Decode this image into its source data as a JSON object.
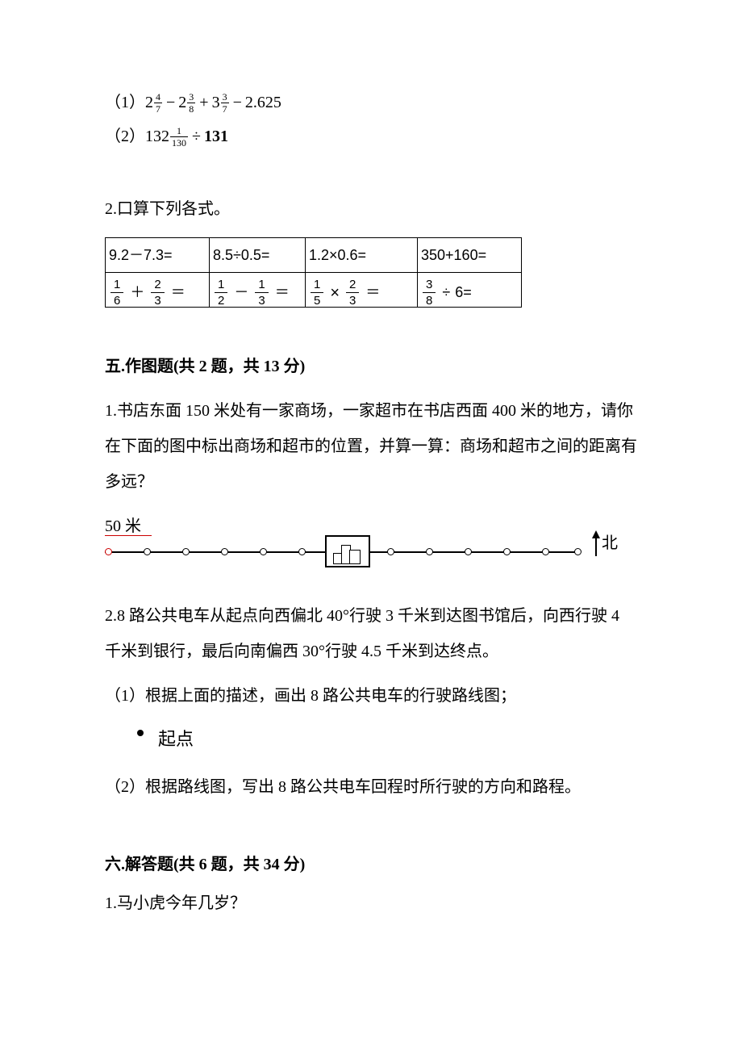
{
  "eq1": {
    "prefix": "（1）",
    "a_int": "2",
    "a_num": "4",
    "a_den": "7",
    "b_int": "2",
    "b_num": "3",
    "b_den": "8",
    "c_int": "3",
    "c_num": "3",
    "c_den": "7",
    "tail": "2.625"
  },
  "eq2": {
    "prefix": "（2）",
    "a_int": "132",
    "a_num": "1",
    "a_den": "130",
    "b": "131"
  },
  "q2_title": "2.口算下列各式。",
  "table": {
    "r1": [
      "9.2－7.3=",
      "8.5÷0.5=",
      "1.2×0.6=",
      "350+160="
    ],
    "r2": {
      "c1": {
        "an": "1",
        "ad": "6",
        "op": "＋",
        "bn": "2",
        "bd": "3"
      },
      "c2": {
        "an": "1",
        "ad": "2",
        "op": "－",
        "bn": "1",
        "bd": "3"
      },
      "c3": {
        "an": "1",
        "ad": "5",
        "opImg": "×",
        "bn": "2",
        "bd": "3"
      },
      "c4": {
        "an": "3",
        "ad": "8",
        "op": "÷",
        "b": "6"
      }
    },
    "eq_sign": "＝"
  },
  "sec5": {
    "title": "五.作图题(共 2 题，共 13 分)",
    "q1": "1.书店东面 150 米处有一家商场，一家超市在书店西面 400 米的地方，请你在下面的图中标出商场和超市的位置，并算一算：商场和超市之间的距离有多远？",
    "scale": "50 米",
    "north": "北",
    "q2": "2.8 路公共电车从起点向西偏北 40°行驶 3 千米到达图书馆后，向西行驶 4 千米到银行，最后向南偏西 30°行驶 4.5 千米到达终点。",
    "q2a": "（1）根据上面的描述，画出 8 路公共电车的行驶路线图；",
    "start": "起点",
    "q2b": "（2）根据路线图，写出 8 路公共电车回程时所行驶的方向和路程。"
  },
  "sec6": {
    "title": "六.解答题(共 6 题，共 34 分)",
    "q1": "1.马小虎今年几岁？"
  }
}
